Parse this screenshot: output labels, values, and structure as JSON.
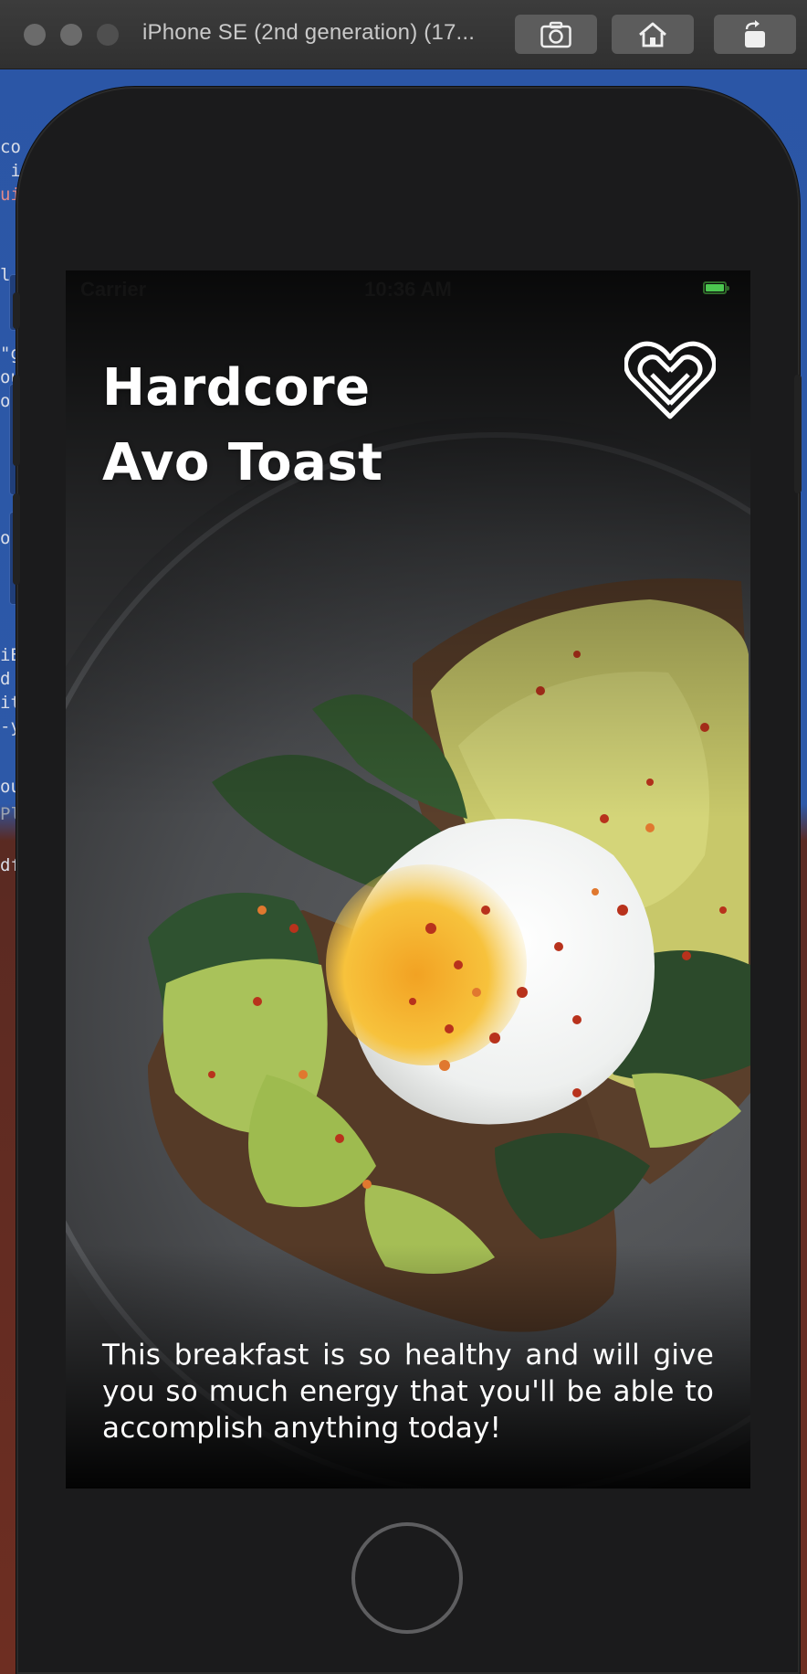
{
  "simulator": {
    "title": "iPhone SE (2nd generation) (17...",
    "buttons": [
      {
        "name": "screenshot",
        "icon": "camera-icon"
      },
      {
        "name": "home",
        "icon": "house-icon"
      },
      {
        "name": "rotate",
        "icon": "rotate-icon"
      }
    ]
  },
  "status_bar": {
    "carrier": "Carrier",
    "time": "10:36 AM",
    "battery_level": 1.0
  },
  "recipe": {
    "title_line1": "Hardcore",
    "title_line2": "Avo Toast",
    "favorite_icon": "heart-icon",
    "description": "This breakfast is so healthy and will give you so much energy that you'll be able to accomplish anything today!"
  },
  "colors": {
    "status_battery": "#4cc750",
    "title_text": "#ffffff",
    "device_body": "#1b1b1c"
  }
}
